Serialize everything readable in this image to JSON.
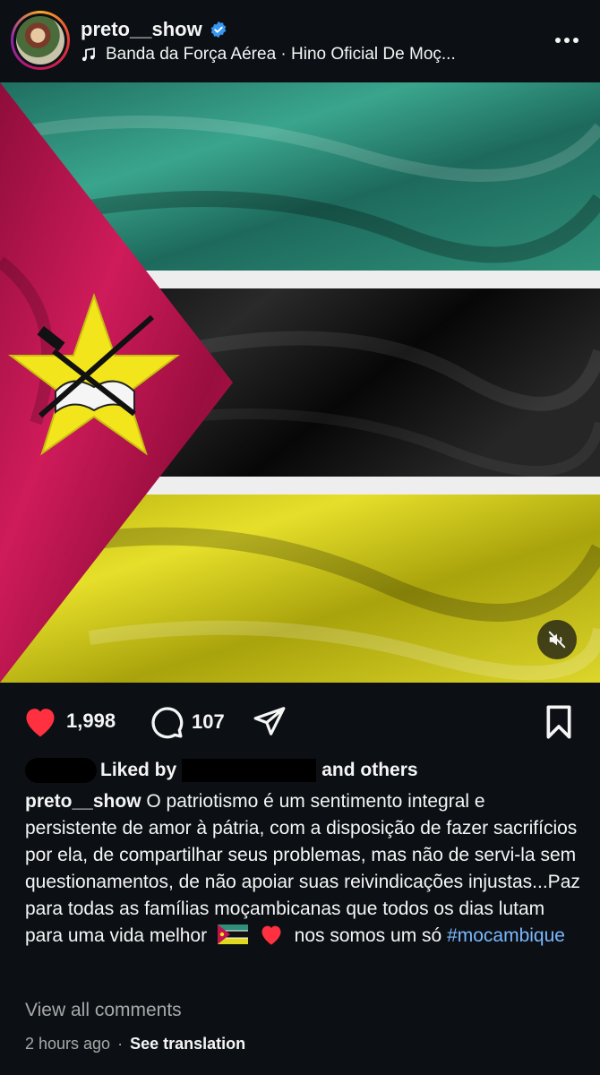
{
  "post": {
    "username": "preto__show",
    "audio": "Banda da Força Aérea · Hino Oficial De Moç...",
    "likes": "1,998",
    "comments": "107",
    "liked_by_prefix": "Liked by",
    "liked_by_suffix": "and others",
    "caption_user": "preto__show",
    "caption_text": "O patriotismo é um sentimento integral e persistente de amor à pátria, com a disposição de fazer sacrifícios por ela, de compartilhar seus problemas, mas não de servi-la sem questionamentos, de não apoiar suas reivindicações injustas...Paz para todas as famílias moçambicanas que todos os dias lutam para uma vida melhor",
    "caption_tail": "nos somos um só",
    "hashtag": "#mocambique",
    "view_comments": "View all comments",
    "time_ago": "2 hours ago",
    "separator": "·",
    "see_translation": "See translation"
  },
  "colors": {
    "background": "#0c1014",
    "like_red": "#ff3040",
    "hashtag_blue": "#7ab8ff",
    "flag_green": "#2f8f7a",
    "flag_black": "#0a0a0a",
    "flag_yellow": "#d9d21a",
    "flag_red": "#c2134f"
  },
  "icons": {
    "verified": "verified-badge-icon",
    "music": "music-note-icon",
    "more": "more-options-icon",
    "mute": "muted-speaker-icon",
    "like": "heart-icon",
    "comment": "comment-icon",
    "share": "share-icon",
    "save": "bookmark-icon"
  }
}
